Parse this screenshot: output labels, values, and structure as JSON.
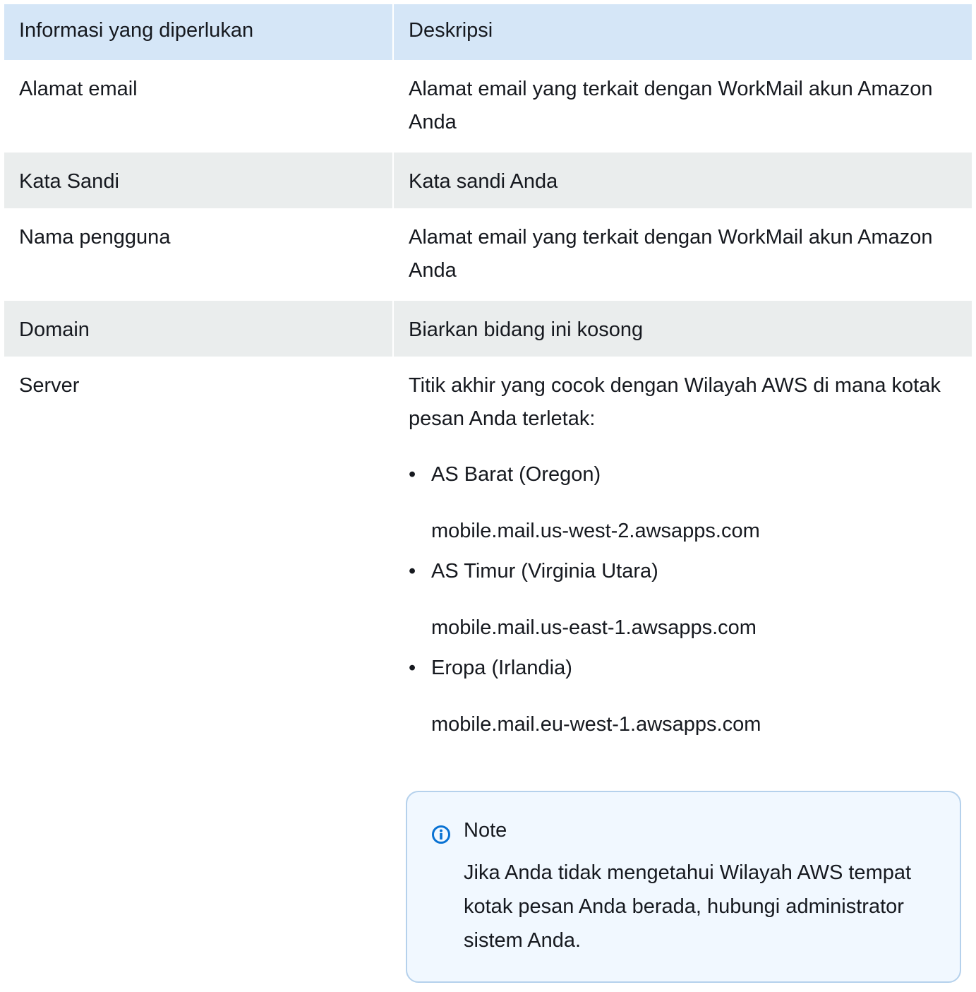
{
  "table": {
    "headers": [
      "Informasi yang diperlukan",
      "Deskripsi"
    ],
    "rows": [
      {
        "label": "Alamat email",
        "description": "Alamat email yang terkait dengan WorkMail akun Amazon Anda"
      },
      {
        "label": "Kata Sandi",
        "description": "Kata sandi Anda"
      },
      {
        "label": "Nama pengguna",
        "description": "Alamat email yang terkait dengan WorkMail akun Amazon Anda"
      },
      {
        "label": "Domain",
        "description": "Biarkan bidang ini kosong"
      },
      {
        "label": "Server",
        "description": "Titik akhir yang cocok dengan Wilayah AWS di mana kotak pesan Anda terletak:"
      }
    ]
  },
  "server": {
    "bullet": "•",
    "regions": [
      {
        "name": "AS Barat (Oregon)",
        "endpoint": "mobile.mail.us-west-2.awsapps.com"
      },
      {
        "name": "AS Timur (Virginia Utara)",
        "endpoint": "mobile.mail.us-east-1.awsapps.com"
      },
      {
        "name": "Eropa (Irlandia)",
        "endpoint": "mobile.mail.eu-west-1.awsapps.com"
      }
    ]
  },
  "note": {
    "icon": "info-icon",
    "title": "Note",
    "body": "Jika Anda tidak mengetahui Wilayah AWS tempat kotak pesan Anda berada, hubungi administrator sistem Anda."
  },
  "colors": {
    "header_bg": "#d5e6f7",
    "stripe_bg": "#eaeded",
    "note_bg": "#f1f8ff",
    "note_border": "#b5d1ec",
    "info_icon": "#0972d3"
  }
}
